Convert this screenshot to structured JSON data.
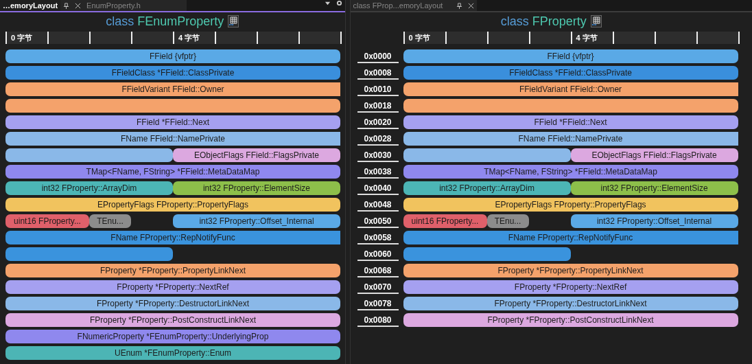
{
  "panels": [
    {
      "tabs": [
        {
          "label": "…emoryLayout",
          "selected": true
        },
        {
          "label": "EnumProperty.h",
          "selected": false
        }
      ],
      "tab_tools": true,
      "title": {
        "keyword": "class",
        "name": "FEnumProperty"
      },
      "ruler": [
        "0 字节",
        "4 字节"
      ],
      "rows": [
        {
          "fields": [
            {
              "kind": "full",
              "label": "FField {vfptr}",
              "color": "#5aa9e6"
            }
          ]
        },
        {
          "fields": [
            {
              "kind": "full",
              "label": "FFieldClass *FField::ClassPrivate",
              "color": "#3a8fdc"
            }
          ]
        },
        {
          "fields": [
            {
              "kind": "full",
              "label": "FFieldVariant FField::Owner",
              "color": "#f4a26b",
              "continues": true
            }
          ]
        },
        {
          "fields": [
            {
              "kind": "full",
              "color": "#f4a26b"
            }
          ]
        },
        {
          "fields": [
            {
              "kind": "full",
              "label": "FField *FField::Next",
              "color": "#a5a0f0"
            }
          ]
        },
        {
          "fields": [
            {
              "kind": "full",
              "label": "FName FField::NamePrivate",
              "color": "#8ab8e8",
              "continues": true
            }
          ]
        },
        {
          "fields": [
            {
              "kind": "half",
              "color": "#8ab8e8"
            },
            {
              "kind": "half",
              "label": "EObjectFlags FField::FlagsPrivate",
              "color": "#dca8e0"
            }
          ]
        },
        {
          "fields": [
            {
              "kind": "full",
              "label": "TMap<FName, FString> *FField::MetaDataMap",
              "color": "#8f88ee"
            }
          ]
        },
        {
          "fields": [
            {
              "kind": "half",
              "label": "int32 FProperty::ArrayDim",
              "color": "#4cb5b5"
            },
            {
              "kind": "half",
              "label": "int32 FProperty::ElementSize",
              "color": "#8dbf4a"
            }
          ]
        },
        {
          "fields": [
            {
              "kind": "full",
              "label": "EPropertyFlags FProperty::PropertyFlags",
              "color": "#f1c35e"
            }
          ]
        },
        {
          "fields": [
            {
              "kind": "short",
              "label": "uint16 FProperty...",
              "color": "#e0606a"
            },
            {
              "kind": "byte",
              "label": "TEnu...",
              "color": "#8c8c8c"
            },
            {
              "kind": "gap"
            },
            {
              "kind": "half",
              "label": "int32 FProperty::Offset_Internal",
              "color": "#5aa9e6"
            }
          ]
        },
        {
          "fields": [
            {
              "kind": "full",
              "label": "FName FProperty::RepNotifyFunc",
              "color": "#3a93dd",
              "continues": true
            }
          ]
        },
        {
          "fields": [
            {
              "kind": "half",
              "color": "#3a93dd"
            }
          ]
        },
        {
          "fields": [
            {
              "kind": "full",
              "label": "FProperty *FProperty::PropertyLinkNext",
              "color": "#f4a26b"
            }
          ]
        },
        {
          "fields": [
            {
              "kind": "full",
              "label": "FProperty *FProperty::NextRef",
              "color": "#a5a0f0"
            }
          ]
        },
        {
          "fields": [
            {
              "kind": "full",
              "label": "FProperty *FProperty::DestructorLinkNext",
              "color": "#8ab8e8"
            }
          ]
        },
        {
          "fields": [
            {
              "kind": "full",
              "label": "FProperty *FProperty::PostConstructLinkNext",
              "color": "#dca8e0"
            }
          ]
        },
        {
          "fields": [
            {
              "kind": "full",
              "label": "FNumericProperty *FEnumProperty::UnderlyingProp",
              "color": "#8f88ee"
            }
          ]
        },
        {
          "fields": [
            {
              "kind": "full",
              "label": "UEnum *FEnumProperty::Enum",
              "color": "#4cb5b5"
            }
          ]
        }
      ]
    },
    {
      "tabs": [
        {
          "label": "class FProp...emoryLayout",
          "selected": false
        }
      ],
      "tab_tools": false,
      "title": {
        "keyword": "class",
        "name": "FProperty"
      },
      "ruler": [
        "0 字节",
        "4 字节"
      ],
      "rows": [
        {
          "offset": "0x0000",
          "fields": [
            {
              "kind": "full",
              "label": "FField {vfptr}",
              "color": "#5aa9e6"
            }
          ]
        },
        {
          "offset": "0x0008",
          "fields": [
            {
              "kind": "full",
              "label": "FFieldClass *FField::ClassPrivate",
              "color": "#3a8fdc"
            }
          ]
        },
        {
          "offset": "0x0010",
          "fields": [
            {
              "kind": "full",
              "label": "FFieldVariant FField::Owner",
              "color": "#f4a26b",
              "continues": true
            }
          ]
        },
        {
          "offset": "0x0018",
          "fields": [
            {
              "kind": "full",
              "color": "#f4a26b"
            }
          ]
        },
        {
          "offset": "0x0020",
          "fields": [
            {
              "kind": "full",
              "label": "FField *FField::Next",
              "color": "#a5a0f0"
            }
          ]
        },
        {
          "offset": "0x0028",
          "fields": [
            {
              "kind": "full",
              "label": "FName FField::NamePrivate",
              "color": "#8ab8e8",
              "continues": true
            }
          ]
        },
        {
          "offset": "0x0030",
          "fields": [
            {
              "kind": "half",
              "color": "#8ab8e8"
            },
            {
              "kind": "half",
              "label": "EObjectFlags FField::FlagsPrivate",
              "color": "#dca8e0"
            }
          ]
        },
        {
          "offset": "0x0038",
          "fields": [
            {
              "kind": "full",
              "label": "TMap<FName, FString> *FField::MetaDataMap",
              "color": "#8f88ee"
            }
          ]
        },
        {
          "offset": "0x0040",
          "fields": [
            {
              "kind": "half",
              "label": "int32 FProperty::ArrayDim",
              "color": "#4cb5b5"
            },
            {
              "kind": "half",
              "label": "int32 FProperty::ElementSize",
              "color": "#8dbf4a"
            }
          ]
        },
        {
          "offset": "0x0048",
          "fields": [
            {
              "kind": "full",
              "label": "EPropertyFlags FProperty::PropertyFlags",
              "color": "#f1c35e"
            }
          ]
        },
        {
          "offset": "0x0050",
          "fields": [
            {
              "kind": "short",
              "label": "uint16 FProperty...",
              "color": "#e0606a"
            },
            {
              "kind": "byte",
              "label": "TEnu...",
              "color": "#8c8c8c"
            },
            {
              "kind": "gap"
            },
            {
              "kind": "half",
              "label": "int32 FProperty::Offset_Internal",
              "color": "#5aa9e6"
            }
          ]
        },
        {
          "offset": "0x0058",
          "fields": [
            {
              "kind": "full",
              "label": "FName FProperty::RepNotifyFunc",
              "color": "#3a93dd",
              "continues": true
            }
          ]
        },
        {
          "offset": "0x0060",
          "fields": [
            {
              "kind": "half",
              "color": "#3a93dd"
            }
          ]
        },
        {
          "offset": "0x0068",
          "fields": [
            {
              "kind": "full",
              "label": "FProperty *FProperty::PropertyLinkNext",
              "color": "#f4a26b"
            }
          ]
        },
        {
          "offset": "0x0070",
          "fields": [
            {
              "kind": "full",
              "label": "FProperty *FProperty::NextRef",
              "color": "#a5a0f0"
            }
          ]
        },
        {
          "offset": "0x0078",
          "fields": [
            {
              "kind": "full",
              "label": "FProperty *FProperty::DestructorLinkNext",
              "color": "#8ab8e8"
            }
          ]
        },
        {
          "offset": "0x0080",
          "fields": [
            {
              "kind": "full",
              "label": "FProperty *FProperty::PostConstructLinkNext",
              "color": "#dca8e0"
            }
          ]
        }
      ]
    }
  ]
}
